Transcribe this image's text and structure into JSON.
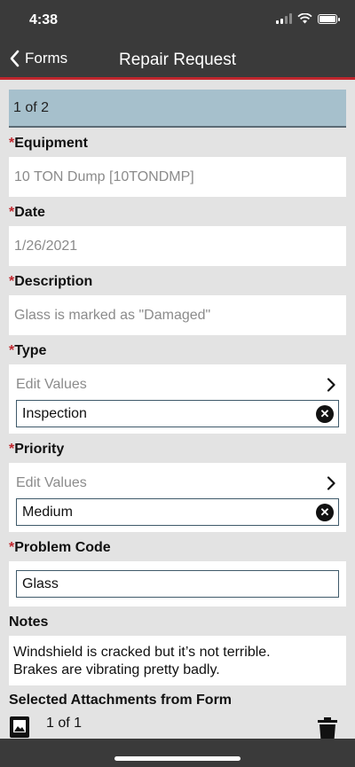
{
  "status": {
    "time": "4:38"
  },
  "nav": {
    "back_label": "Forms",
    "title": "Repair Request"
  },
  "page_indicator": "1 of 2",
  "fields": {
    "equipment": {
      "label": "Equipment",
      "value": "10 TON Dump [10TONDMP]"
    },
    "date": {
      "label": "Date",
      "value": "1/26/2021"
    },
    "description": {
      "label": "Description",
      "value": "Glass is marked as \"Damaged\""
    },
    "type": {
      "label": "Type",
      "edit_label": "Edit Values",
      "value": "Inspection"
    },
    "priority": {
      "label": "Priority",
      "edit_label": "Edit Values",
      "value": "Medium"
    },
    "problem_code": {
      "label": "Problem Code",
      "value": "Glass"
    },
    "notes": {
      "label": "Notes",
      "line1": "Windshield is cracked but it’s not terrible.",
      "line2": "Brakes are vibrating pretty badly."
    }
  },
  "attachments": {
    "label": "Selected Attachments from Form",
    "count": "1 of 1"
  },
  "required_marker": "*",
  "clear_glyph": "✕",
  "icons": [
    "signal-icon",
    "wifi-icon",
    "battery-icon",
    "chevron-left-icon",
    "chevron-right-icon",
    "clear-icon",
    "image-icon",
    "trash-icon"
  ],
  "colors": {
    "bar": "#3a3a3a",
    "accent_red": "#c0262d",
    "page_indicator_bg": "#a6c0cc",
    "background": "#e3e3e3"
  }
}
